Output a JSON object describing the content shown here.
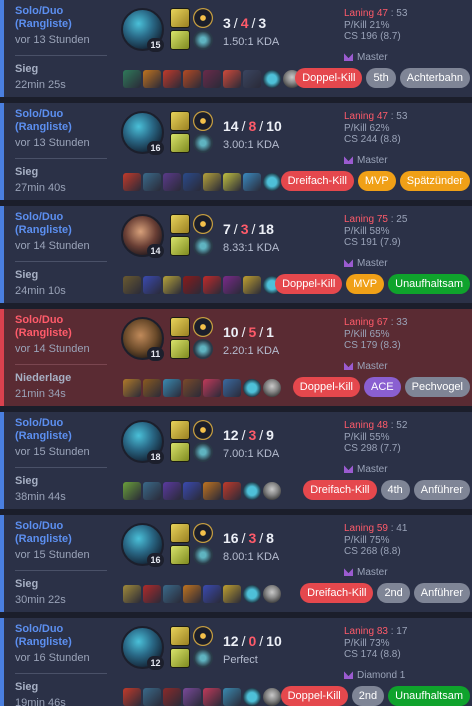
{
  "matches": [
    {
      "queue": "Solo/Duo (Rangliste)",
      "ago": "vor 13 Stunden",
      "result": "Sieg",
      "duration": "22min 25s",
      "champion": "champion-1",
      "level": "15",
      "kills": "3",
      "deaths": "4",
      "assists": "3",
      "kda": "1.50:1 KDA",
      "laning_label": "Laning",
      "laning_left": "47",
      "laning_right": "53",
      "pkill": "P/Kill 21%",
      "cs": "CS 196 (8.7)",
      "rank": "Master",
      "items": [
        "#2f7a5a",
        "#c0731f",
        "#c23a2a",
        "#b54a23",
        "#6a2a4a",
        "#d04a3a",
        "#3a4560",
        "#4ec0d8",
        "#8a8a8a"
      ],
      "badges": [
        {
          "text": "Doppel-Kill",
          "style": "kill"
        },
        {
          "text": "5th",
          "style": "gray"
        },
        {
          "text": "Achterbahn",
          "style": "gray"
        }
      ]
    },
    {
      "queue": "Solo/Duo (Rangliste)",
      "ago": "vor 13 Stunden",
      "result": "Sieg",
      "duration": "27min 40s",
      "champion": "champion-1",
      "level": "16",
      "kills": "14",
      "deaths": "8",
      "assists": "10",
      "kda": "3.00:1 KDA",
      "laning_label": "Laning",
      "laning_left": "47",
      "laning_right": "53",
      "pkill": "P/Kill 62%",
      "cs": "CS 244 (8.8)",
      "rank": "Master",
      "items": [
        "#c23a2a",
        "#3a6a8a",
        "#5a3a8a",
        "#2a4a8a",
        "#b5a23a",
        "#c0c040",
        "#3a8ac0",
        "#4ec0d8",
        "#8a8a8a"
      ],
      "badges": [
        {
          "text": "Dreifach-Kill",
          "style": "kill"
        },
        {
          "text": "MVP",
          "style": "mvp"
        },
        {
          "text": "Spätzünder",
          "style": "mvp"
        }
      ]
    },
    {
      "queue": "Solo/Duo (Rangliste)",
      "ago": "vor 14 Stunden",
      "result": "Sieg",
      "duration": "24min 10s",
      "champion": "champion-2",
      "level": "14",
      "kills": "7",
      "deaths": "3",
      "assists": "18",
      "kda": "8.33:1 KDA",
      "laning_label": "Laning",
      "laning_left": "75",
      "laning_right": "25",
      "pkill": "P/Kill 58%",
      "cs": "CS 191 (7.9)",
      "rank": "Master",
      "items": [
        "#6a5a30",
        "#3a4ab0",
        "#b5a23a",
        "#8a1a1a",
        "#c02a2a",
        "#7a2a8a",
        "#c0a030",
        "#4ec0d8",
        "#8a8a8a"
      ],
      "badges": [
        {
          "text": "Doppel-Kill",
          "style": "kill"
        },
        {
          "text": "MVP",
          "style": "mvp"
        },
        {
          "text": "Unaufhaltsam",
          "style": "unst"
        }
      ]
    },
    {
      "queue": "Solo/Duo (Rangliste)",
      "ago": "vor 14 Stunden",
      "result": "Niederlage",
      "duration": "21min 34s",
      "champion": "champion-3",
      "level": "11",
      "kills": "10",
      "deaths": "5",
      "assists": "1",
      "kda": "2.20:1 KDA",
      "laning_label": "Laning",
      "laning_left": "67",
      "laning_right": "33",
      "pkill": "P/Kill 65%",
      "cs": "CS 179 (8.3)",
      "rank": "Master",
      "items": [
        "#b07a2a",
        "#8a5a20",
        "#3a8ab0",
        "#7a4a2a",
        "#c03a5a",
        "#3a6aa0",
        "#4ec0d8",
        "#8a8a8a"
      ],
      "badges": [
        {
          "text": "Doppel-Kill",
          "style": "kill"
        },
        {
          "text": "ACE",
          "style": "ace"
        },
        {
          "text": "Pechvogel",
          "style": "gray"
        }
      ]
    },
    {
      "queue": "Solo/Duo (Rangliste)",
      "ago": "vor 15 Stunden",
      "result": "Sieg",
      "duration": "38min 44s",
      "champion": "champion-1",
      "level": "18",
      "kills": "12",
      "deaths": "3",
      "assists": "9",
      "kda": "7.00:1 KDA",
      "laning_label": "Laning",
      "laning_left": "48",
      "laning_right": "52",
      "pkill": "P/Kill 55%",
      "cs": "CS 298 (7.7)",
      "rank": "Master",
      "items": [
        "#6aa03a",
        "#3a6a8a",
        "#5a3aa0",
        "#3a4ab0",
        "#c0731f",
        "#c23a2a",
        "#4ec0d8",
        "#8a8a8a"
      ],
      "badges": [
        {
          "text": "Dreifach-Kill",
          "style": "kill"
        },
        {
          "text": "4th",
          "style": "gray"
        },
        {
          "text": "Anführer",
          "style": "gray"
        }
      ]
    },
    {
      "queue": "Solo/Duo (Rangliste)",
      "ago": "vor 15 Stunden",
      "result": "Sieg",
      "duration": "30min 22s",
      "champion": "champion-1",
      "level": "16",
      "kills": "16",
      "deaths": "3",
      "assists": "8",
      "kda": "8.00:1 KDA",
      "laning_label": "Laning",
      "laning_left": "59",
      "laning_right": "41",
      "pkill": "P/Kill 75%",
      "cs": "CS 268 (8.8)",
      "rank": "Master",
      "items": [
        "#a08a3a",
        "#b02a2a",
        "#3a6a8a",
        "#c0731f",
        "#3a4ab0",
        "#c0a030",
        "#4ec0d8",
        "#8a8a8a"
      ],
      "badges": [
        {
          "text": "Dreifach-Kill",
          "style": "kill"
        },
        {
          "text": "2nd",
          "style": "gray"
        },
        {
          "text": "Anführer",
          "style": "gray"
        }
      ]
    },
    {
      "queue": "Solo/Duo (Rangliste)",
      "ago": "vor 16 Stunden",
      "result": "Sieg",
      "duration": "19min 46s",
      "champion": "champion-1",
      "level": "12",
      "kills": "12",
      "deaths": "0",
      "assists": "10",
      "kda": "Perfect",
      "laning_label": "Laning",
      "laning_left": "83",
      "laning_right": "17",
      "pkill": "P/Kill 73%",
      "cs": "CS 174 (8.8)",
      "rank": "Diamond 1",
      "items": [
        "#c23a2a",
        "#3a6a8a",
        "#8a2a2a",
        "#7a4a9a",
        "#c03a5a",
        "#3a8ab0",
        "#4ec0d8",
        "#8a8a8a"
      ],
      "badges": [
        {
          "text": "Doppel-Kill",
          "style": "kill"
        },
        {
          "text": "2nd",
          "style": "gray"
        },
        {
          "text": "Unaufhaltsam",
          "style": "unst"
        }
      ]
    }
  ]
}
